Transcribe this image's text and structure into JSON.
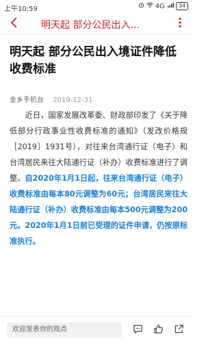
{
  "status_bar": {
    "time": "上午10:59",
    "network": "4G",
    "battery": "34"
  },
  "header": {
    "title": "明天起 部分公民出入..."
  },
  "article": {
    "title": "明天起 部分公民出入境证件降低收费标准",
    "source": "金乡手机台",
    "date": "2019-12-31",
    "paragraph_normal": "　　近日，国家发展改革委、财政部印发了《关于降低部分行政事业性收费标准的通知》（发改价格规［2019］1931号），对往来台湾通行证（电子）和台湾居民来往大陆通行证（补办）收费标准进行了调整。",
    "paragraph_highlight": "自2020年1月1日起，往来台湾通行证（电子）收费标准由每本80元调整为60元；台湾居民来往大陆通行证（补办）收费标准由每本500元调整为200元。2020年1月1日前已受理的证件申请，仍按原标准执行。"
  },
  "bottom_bar": {
    "comment_placeholder": "欢迎发表你的观点"
  },
  "colors": {
    "accent_red": "#c8242a",
    "highlight_blue": "#1b7fd4"
  }
}
